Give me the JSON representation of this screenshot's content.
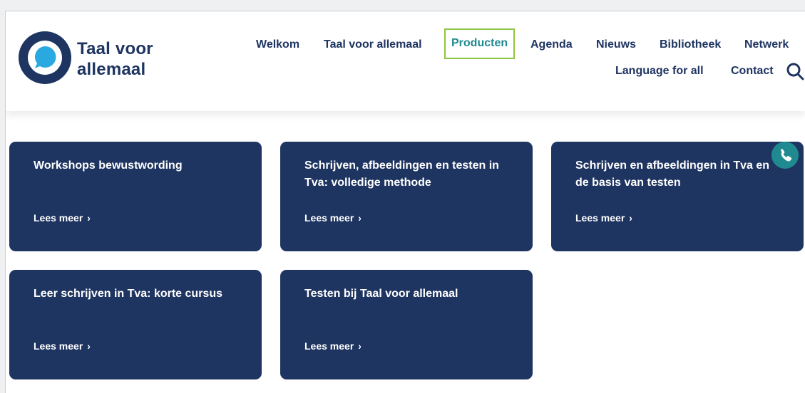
{
  "brand": {
    "line1": "Taal voor",
    "line2": "allemaal"
  },
  "nav": {
    "welkom": "Welkom",
    "taal_voor_allemaal": "Taal voor allemaal",
    "producten": "Producten",
    "agenda": "Agenda",
    "nieuws": "Nieuws",
    "bibliotheek": "Bibliotheek",
    "netwerk": "Netwerk",
    "language_for_all": "Language for all",
    "contact": "Contact"
  },
  "cards": [
    {
      "title": "Workshops bewustwording",
      "link": "Lees meer"
    },
    {
      "title": "Schrijven, afbeeldingen en testen in Tva: volledige methode",
      "link": "Lees meer"
    },
    {
      "title": "Schrijven en afbeeldingen in Tva en de basis van testen",
      "link": "Lees meer"
    },
    {
      "title": "Leer schrijven in Tva: korte cursus",
      "link": "Lees meer"
    },
    {
      "title": "Testen bij Taal voor allemaal",
      "link": "Lees meer"
    }
  ],
  "icons": {
    "search": "search-icon",
    "phone": "phone-icon",
    "chevron": "chevron-right-icon",
    "logo": "speech-bubble-logo-icon"
  },
  "colors": {
    "navy": "#1e3461",
    "teal": "#1f8a8f",
    "highlight_border": "#8cc540",
    "light_blue": "#2aa9e0"
  }
}
